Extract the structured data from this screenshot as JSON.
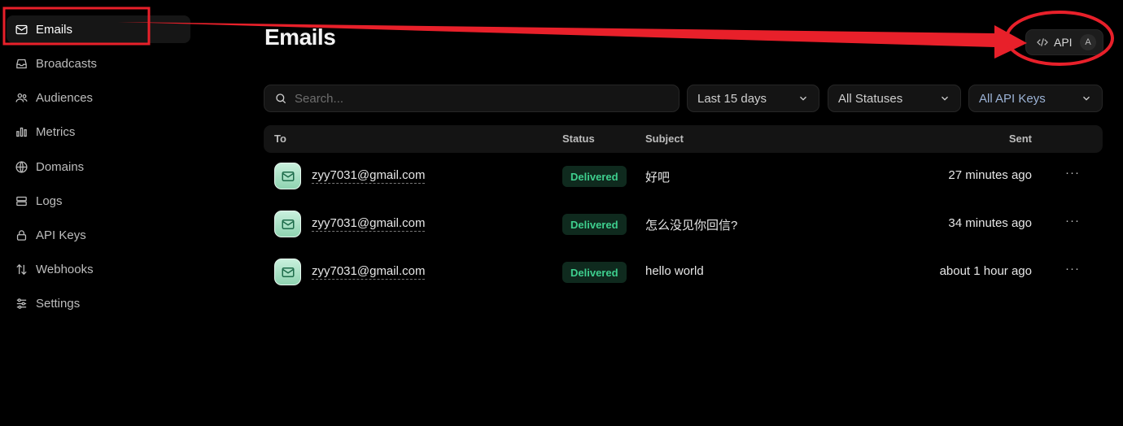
{
  "sidebar": {
    "items": [
      {
        "label": "Emails",
        "icon": "mail-icon",
        "active": true
      },
      {
        "label": "Broadcasts",
        "icon": "inbox-icon"
      },
      {
        "label": "Audiences",
        "icon": "users-icon"
      },
      {
        "label": "Metrics",
        "icon": "bar-chart-icon"
      },
      {
        "label": "Domains",
        "icon": "globe-icon"
      },
      {
        "label": "Logs",
        "icon": "logs-icon"
      },
      {
        "label": "API Keys",
        "icon": "lock-icon"
      },
      {
        "label": "Webhooks",
        "icon": "arrows-icon"
      },
      {
        "label": "Settings",
        "icon": "sliders-icon"
      }
    ]
  },
  "header": {
    "title": "Emails",
    "api_button": {
      "label": "API",
      "shortcut": "A",
      "icon": "code-icon"
    }
  },
  "filters": {
    "search_placeholder": "Search...",
    "date_range": "Last 15 days",
    "status": "All Statuses",
    "api_keys": "All API Keys"
  },
  "table": {
    "columns": {
      "to": "To",
      "status": "Status",
      "subject": "Subject",
      "sent": "Sent"
    },
    "rows": [
      {
        "to": "zyy7031@gmail.com",
        "status": "Delivered",
        "subject": "好吧",
        "sent": "27 minutes ago",
        "more": "···"
      },
      {
        "to": "zyy7031@gmail.com",
        "status": "Delivered",
        "subject": "怎么没见你回信?",
        "sent": "34 minutes ago",
        "more": "···"
      },
      {
        "to": "zyy7031@gmail.com",
        "status": "Delivered",
        "subject": "hello world",
        "sent": "about 1 hour ago",
        "more": "···"
      }
    ]
  },
  "colors": {
    "background": "#000000",
    "delivered": "#3ecf8e",
    "annotation": "#e8202a"
  }
}
